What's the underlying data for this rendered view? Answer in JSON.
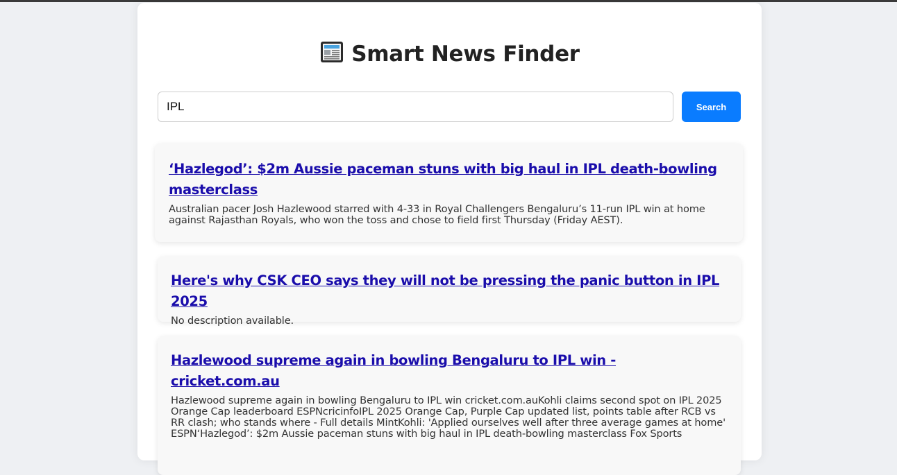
{
  "header": {
    "icon": "newspaper-icon",
    "title": "Smart News Finder"
  },
  "search": {
    "value": "IPL",
    "button_label": "Search"
  },
  "colors": {
    "accent": "#0a7cff",
    "link": "#1a0dab",
    "article_bg": "#f8f8f8"
  },
  "articles": [
    {
      "title": "‘Hazlegod’: $2m Aussie paceman stuns with big haul in IPL death-bowling masterclass",
      "description": "Australian pacer Josh Hazlewood starred with 4-33 in Royal Challengers Bengaluru’s 11-run IPL win at home against Rajasthan Royals, who won the toss and chose to field first Thursday (Friday AEST)."
    },
    {
      "title": "Here's why CSK CEO says they will not be pressing the panic button in IPL 2025",
      "description": "No description available."
    },
    {
      "title": "Hazlewood supreme again in bowling Bengaluru to IPL win - cricket.com.au",
      "description": "Hazlewood supreme again in bowling Bengaluru to IPL win cricket.com.auKohli claims second spot on IPL 2025 Orange Cap leaderboard ESPNcricinfoIPL 2025 Orange Cap, Purple Cap updated list, points table after RCB vs RR clash; who stands where - Full details MintKohli: 'Applied ourselves well after three average games at home' ESPN‘Hazlegod’: $2m Aussie paceman stuns with big haul in IPL death-bowling masterclass Fox Sports"
    }
  ]
}
